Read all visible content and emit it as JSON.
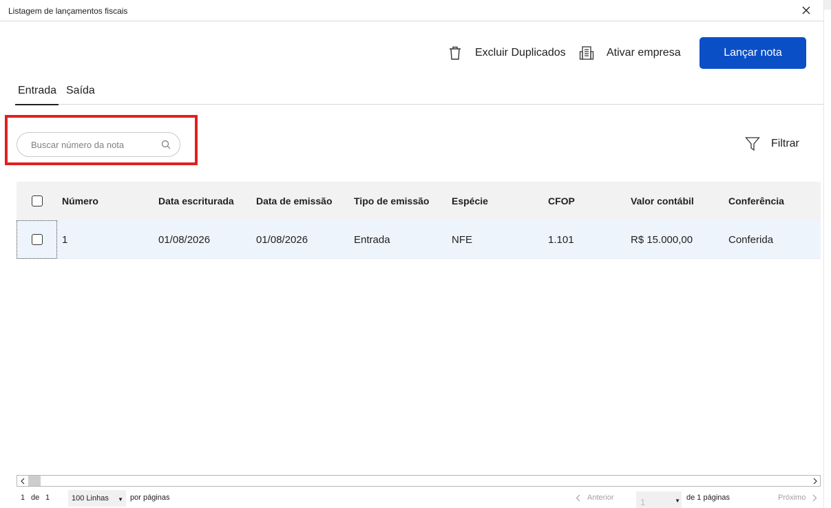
{
  "window": {
    "title": "Listagem de lançamentos fiscais"
  },
  "toolbar": {
    "excluir_label": "Excluir Duplicados",
    "ativar_label": "Ativar empresa",
    "lancar_label": "Lançar nota"
  },
  "tabs": [
    {
      "label": "Entrada",
      "active": true
    },
    {
      "label": "Saída",
      "active": false
    }
  ],
  "search": {
    "placeholder": "Buscar número da nota",
    "value": ""
  },
  "filter": {
    "label": "Filtrar"
  },
  "table": {
    "columns": [
      "Número",
      "Data escriturada",
      "Data de emissão",
      "Tipo de emissão",
      "Espécie",
      "CFOP",
      "Valor contábil",
      "Conferência"
    ],
    "rows": [
      [
        "1",
        "01/08/2026",
        "01/08/2026",
        "Entrada",
        "NFE",
        "1.101",
        "R$ 15.000,00",
        "Conferida"
      ]
    ]
  },
  "pagination": {
    "record_start": "1",
    "of_label": "de",
    "record_total": "1",
    "rows_per_page": "100 Linhas",
    "per_page_label": "por páginas",
    "prev_label": "Anterior",
    "current_page": "1",
    "pages_label": "de 1 páginas",
    "next_label": "Próximo"
  },
  "colors": {
    "primary": "#0b4fc7",
    "highlight": "#e02020",
    "row_bg": "#eef4fc",
    "header_bg": "#f2f2f2"
  }
}
